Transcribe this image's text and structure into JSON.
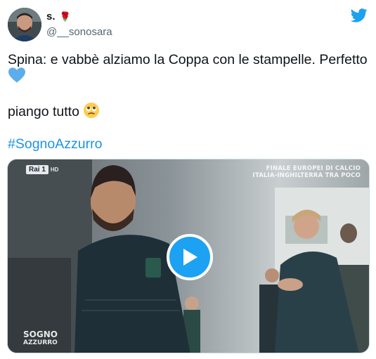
{
  "tweet": {
    "display_name": "s.",
    "name_emoji": "🌹",
    "handle": "@__sonosara",
    "line1": "Spina: e vabbè alziamo la Coppa con le stampelle. Perfetto",
    "line2": "piango tutto",
    "hashtag": "#SognoAzzurro"
  },
  "icons": {
    "brand": "twitter-bird-icon",
    "heart": "blue-heart-icon",
    "emoji": "face-holding-back-tears-icon",
    "play": "play-icon"
  },
  "video": {
    "channel_logo": "Rai 1",
    "channel_hd": "HD",
    "caption_line1": "FINALE EUROPEI DI CALCIO",
    "caption_line2": "ITALIA-INGHILTERRA TRA POCO",
    "watermark_line1": "SOGNO",
    "watermark_line2": "AZZURRO"
  },
  "colors": {
    "link": "#1b95e0",
    "brand_blue": "#1da1f2",
    "text": "#0f1419",
    "secondary": "#536471",
    "heart": "#5dadec"
  }
}
